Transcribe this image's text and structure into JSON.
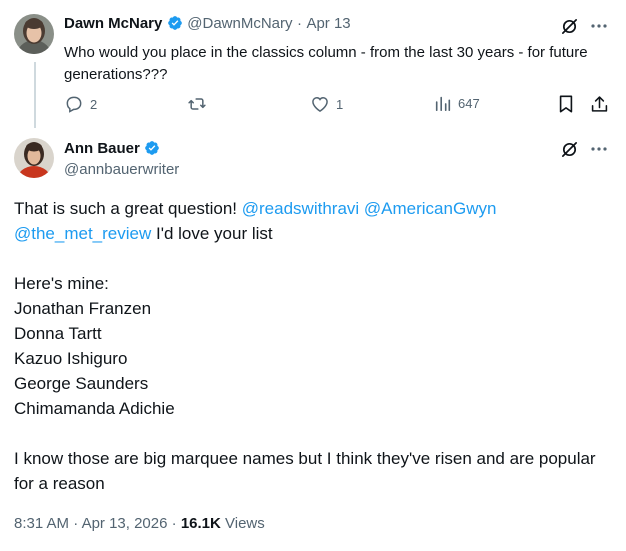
{
  "parent_tweet": {
    "author_name": "Dawn McNary",
    "handle": "@DawnMcNary",
    "separator": "·",
    "date": "Apr 13",
    "text": "Who would you place in the classics column - from the last 30 years - for future generations???",
    "replies": "2",
    "likes": "1",
    "views": "647"
  },
  "reply_tweet": {
    "author_name": "Ann Bauer",
    "handle": "@annbauerwriter",
    "intro": "That is such a great question!",
    "mentions": [
      "@readswithravi",
      "@AmericanGwyn",
      "@the_met_review"
    ],
    "intro_tail": "I'd love your list",
    "list_heading": "Here's mine:",
    "authors": [
      "Jonathan Franzen",
      "Donna Tartt",
      "Kazuo Ishiguro",
      "George Saunders",
      "Chimamanda Adichie"
    ],
    "closing": "I know those are big marquee names but I think they've risen and are popular for a reason",
    "time": "8:31 AM",
    "date": "Apr 13, 2026",
    "separator": "·",
    "views_count": "16.1K",
    "views_label": "Views"
  },
  "icons": {
    "verified": "verified-badge-icon",
    "grok": "grok-icon",
    "more": "more-icon",
    "reply": "reply-icon",
    "retweet": "retweet-icon",
    "like": "like-icon",
    "views": "views-icon",
    "bookmark": "bookmark-icon",
    "share": "share-icon"
  },
  "colors": {
    "text": "#0f1419",
    "muted": "#536471",
    "accent": "#1d9bf0",
    "thread_line": "#cfd9de"
  }
}
